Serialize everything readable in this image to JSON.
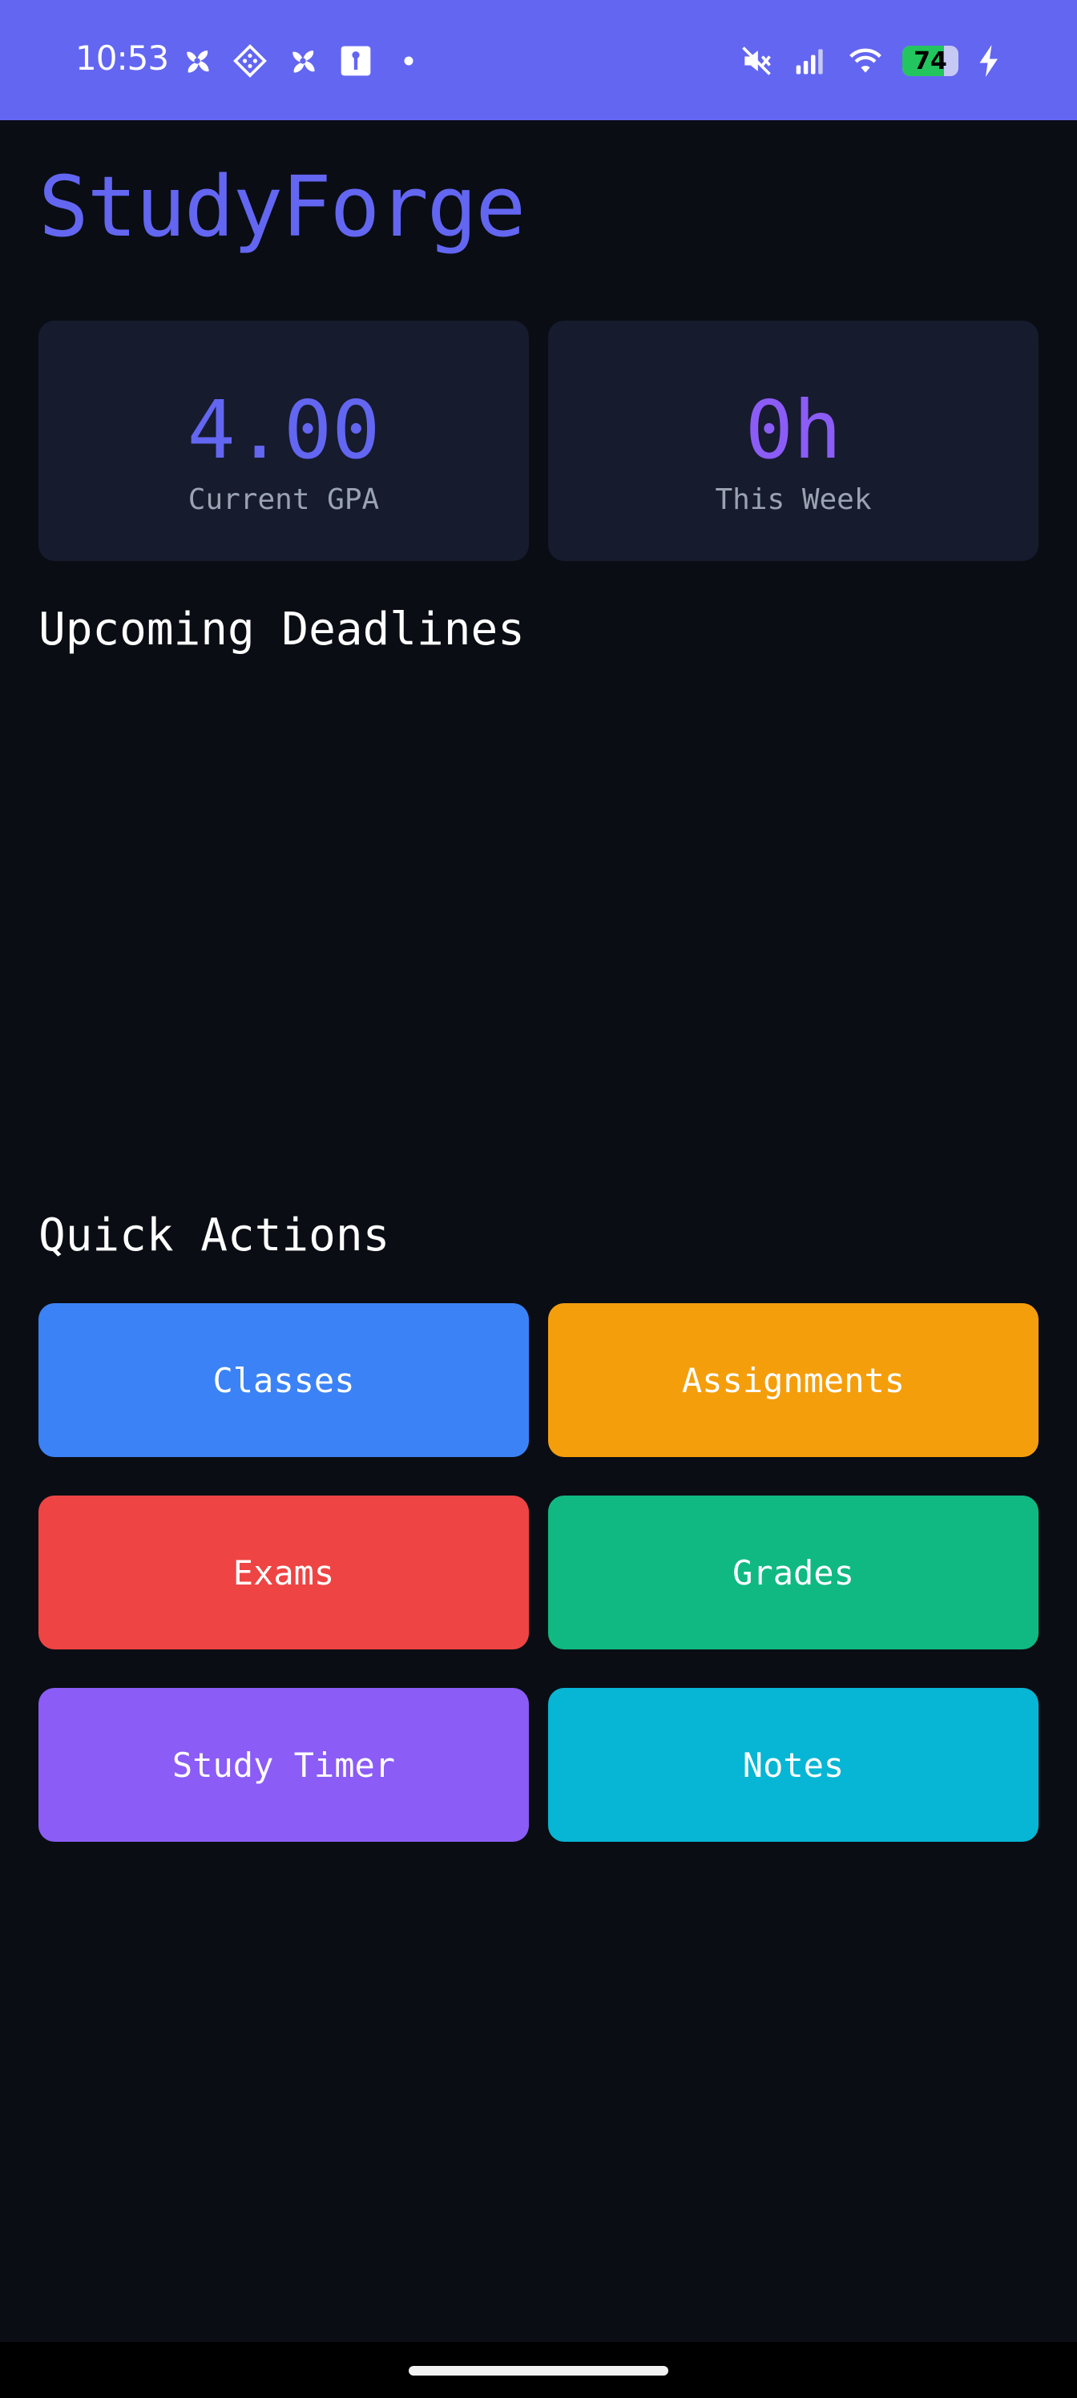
{
  "status_bar": {
    "time": "10:53",
    "battery_level": "74",
    "left_icons": [
      "fan-icon",
      "game-controller-icon",
      "fan-icon",
      "keyhole-icon",
      "dot-icon"
    ],
    "right_icons": [
      "mute-icon",
      "signal-icon",
      "wifi-icon",
      "battery-icon",
      "charging-bolt-icon"
    ]
  },
  "app": {
    "title": "StudyForge",
    "accent_color": "#6366f1",
    "background_color": "#0a0d14"
  },
  "stats": [
    {
      "value": "4.00",
      "label": "Current GPA",
      "color": "#6366f1"
    },
    {
      "value": "0h",
      "label": "This Week",
      "color": "#8b5cf6"
    }
  ],
  "deadlines": {
    "title": "Upcoming Deadlines",
    "items": []
  },
  "quick_actions": {
    "title": "Quick Actions",
    "buttons": [
      {
        "label": "Classes",
        "color": "#3b82f6"
      },
      {
        "label": "Assignments",
        "color": "#f59e0b"
      },
      {
        "label": "Exams",
        "color": "#ef4444"
      },
      {
        "label": "Grades",
        "color": "#10b981"
      },
      {
        "label": "Study Timer",
        "color": "#8b5cf6"
      },
      {
        "label": "Notes",
        "color": "#06b6d4"
      }
    ]
  }
}
